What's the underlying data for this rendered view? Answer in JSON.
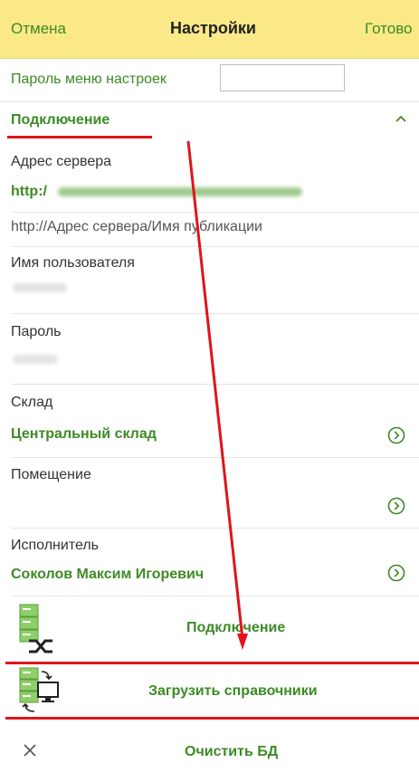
{
  "header": {
    "cancel": "Отмена",
    "title": "Настройки",
    "done": "Готово"
  },
  "password_menu": {
    "label": "Пароль меню настроек",
    "value": ""
  },
  "section": {
    "title": "Подключение"
  },
  "server": {
    "label": "Адрес сервера",
    "value_prefix": "http:/",
    "hint": "http://Адрес сервера/Имя публикации"
  },
  "username": {
    "label": "Имя пользователя"
  },
  "password": {
    "label": "Пароль"
  },
  "warehouse": {
    "label": "Склад",
    "value": "Центральный склад"
  },
  "room": {
    "label": "Помещение",
    "value": ""
  },
  "executor": {
    "label": "Исполнитель",
    "value": "Соколов Максим Игоревич"
  },
  "actions": {
    "connect": "Подключение",
    "load_refs": "Загрузить справочники",
    "clear_db": "Очистить БД"
  },
  "colors": {
    "accent_green": "#3d8a25",
    "header_yellow": "#fbe988",
    "annotation_red": "#e0141a"
  }
}
